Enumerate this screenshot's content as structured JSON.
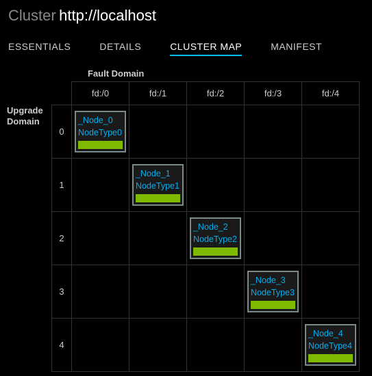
{
  "header": {
    "title_prefix": "Cluster",
    "url": "http://localhost"
  },
  "tabs": [
    {
      "label": "ESSENTIALS",
      "active": false
    },
    {
      "label": "DETAILS",
      "active": false
    },
    {
      "label": "CLUSTER MAP",
      "active": true
    },
    {
      "label": "MANIFEST",
      "active": false
    }
  ],
  "grid": {
    "col_axis_label": "Fault Domain",
    "row_axis_label": "Upgrade Domain",
    "columns": [
      "fd:/0",
      "fd:/1",
      "fd:/2",
      "fd:/3",
      "fd:/4"
    ],
    "rows": [
      "0",
      "1",
      "2",
      "3",
      "4"
    ],
    "nodes": [
      {
        "row": 0,
        "col": 0,
        "name": "_Node_0",
        "type": "NodeType0",
        "health": "ok"
      },
      {
        "row": 1,
        "col": 1,
        "name": "_Node_1",
        "type": "NodeType1",
        "health": "ok"
      },
      {
        "row": 2,
        "col": 2,
        "name": "_Node_2",
        "type": "NodeType2",
        "health": "ok"
      },
      {
        "row": 3,
        "col": 3,
        "name": "_Node_3",
        "type": "NodeType3",
        "health": "ok"
      },
      {
        "row": 4,
        "col": 4,
        "name": "_Node_4",
        "type": "NodeType4",
        "health": "ok"
      }
    ]
  },
  "colors": {
    "accent": "#00bcf2",
    "link": "#00aeef",
    "health_ok": "#7fba00",
    "border": "#333333",
    "node_border": "#7a8a8a"
  }
}
